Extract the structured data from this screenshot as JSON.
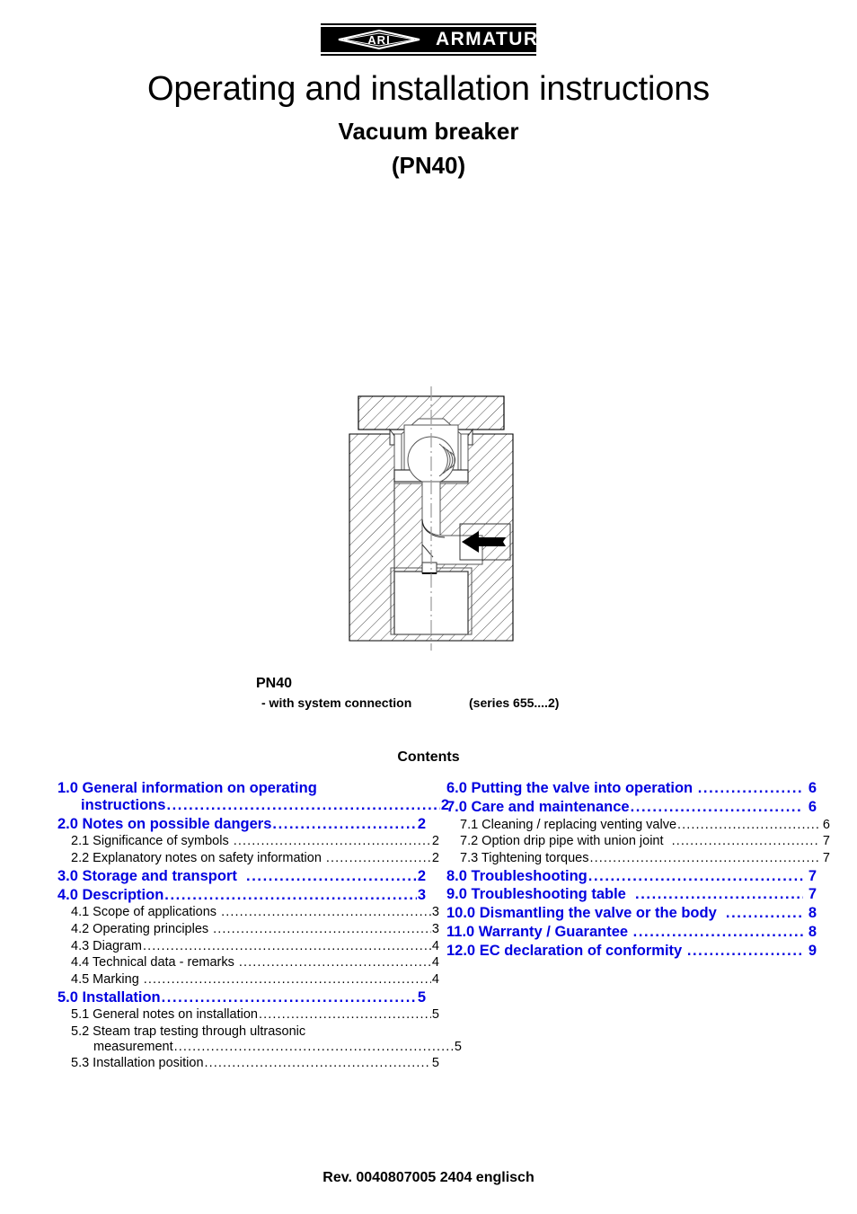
{
  "logo": {
    "mark_text": "ARI",
    "wordmark": "ARMATUREN",
    "diamond_icon": "ari-diamond-icon"
  },
  "header": {
    "title": "Operating and installation instructions",
    "subtitle": "Vacuum breaker",
    "pressure_rating": "(PN40)"
  },
  "figure": {
    "alt": "vacuum-breaker-cross-section",
    "flow_arrow_icon": "flow-direction-arrow",
    "caption_model": "PN40",
    "caption_variant": "- with system connection",
    "caption_series": "(series 655....2)"
  },
  "contents": {
    "heading": "Contents",
    "leader_char": ".",
    "accent_color": "#0000E0",
    "left_column": [
      {
        "level": "major",
        "label": "1.0 General information on operating",
        "label2": "instructions",
        "page": "2",
        "wrapped": true
      },
      {
        "level": "major",
        "label": "2.0 Notes on possible dangers",
        "page": "2"
      },
      {
        "level": "minor",
        "label": "2.1 Significance of symbols ",
        "page": "2"
      },
      {
        "level": "minor",
        "label": "2.2 Explanatory notes on safety information ",
        "page": "2"
      },
      {
        "level": "major",
        "label": "3.0 Storage and transport  ",
        "page": "2"
      },
      {
        "level": "major",
        "label": "4.0 Description",
        "page": "3"
      },
      {
        "level": "minor",
        "label": "4.1 Scope of applications ",
        "page": "3"
      },
      {
        "level": "minor",
        "label": "4.2 Operating principles ",
        "page": "3"
      },
      {
        "level": "minor",
        "label": "4.3 Diagram",
        "page": "4"
      },
      {
        "level": "minor",
        "label": "4.4 Technical data - remarks ",
        "page": "4"
      },
      {
        "level": "minor",
        "label": "4.5 Marking ",
        "page": "4"
      },
      {
        "level": "major",
        "label": "5.0 Installation",
        "page": "5"
      },
      {
        "level": "minor",
        "label": "5.1 General notes on installation",
        "page": "5"
      },
      {
        "level": "minor",
        "label": "5.2 Steam trap testing through ultrasonic",
        "label2": "measurement",
        "page": "5",
        "wrapped": true
      },
      {
        "level": "minor",
        "label": "5.3 Installation position",
        "page": "5"
      }
    ],
    "right_column": [
      {
        "level": "major",
        "label": "6.0 Putting the valve into operation ",
        "page": " 6"
      },
      {
        "level": "major",
        "label": "7.0 Care and maintenance",
        "page": " 6"
      },
      {
        "level": "minor",
        "label": "7.1 Cleaning / replacing venting valve",
        "page": " 6"
      },
      {
        "level": "minor",
        "label": "7.2 Option drip pipe with union joint  ",
        "page": " 7"
      },
      {
        "level": "minor",
        "label": "7.3 Tightening torques",
        "page": " 7"
      },
      {
        "level": "major",
        "label": "8.0 Troubleshooting",
        "page": " 7"
      },
      {
        "level": "major",
        "label": "9.0 Troubleshooting table  ",
        "page": " 7"
      },
      {
        "level": "major",
        "label": "10.0 Dismantling the valve or the body  ",
        "page": " 8"
      },
      {
        "level": "major",
        "label": "11.0 Warranty / Guarantee ",
        "page": " 8"
      },
      {
        "level": "major",
        "label": "12.0 EC declaration of conformity ",
        "page": " 9"
      }
    ]
  },
  "footer": {
    "revision": "Rev. 0040807005 2404 englisch"
  }
}
